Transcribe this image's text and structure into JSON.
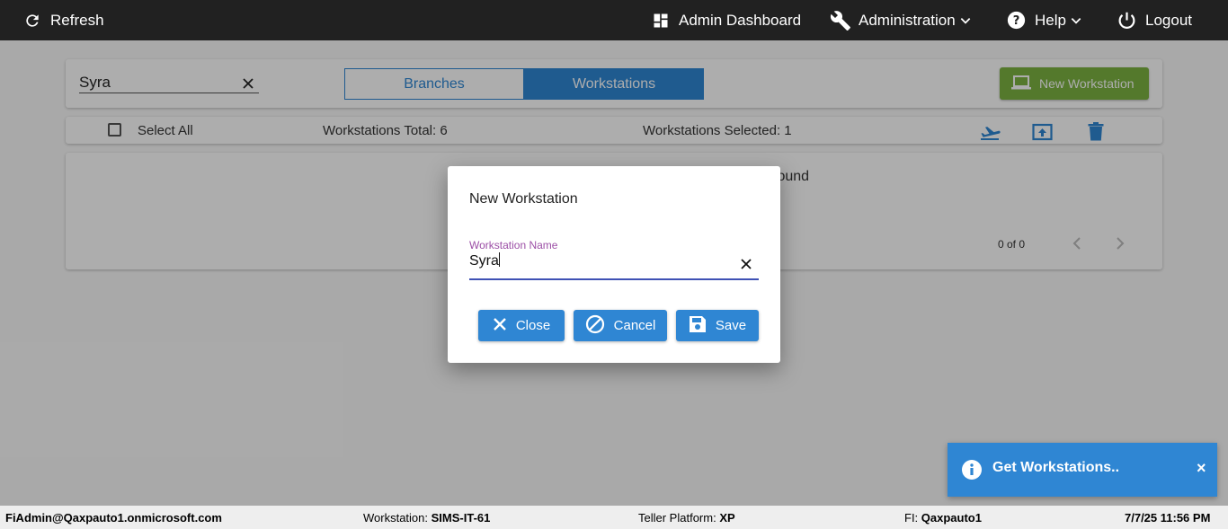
{
  "topbar": {
    "refresh_label": "Refresh",
    "admin_dashboard_label": "Admin Dashboard",
    "administration_label": "Administration",
    "help_label": "Help",
    "logout_label": "Logout"
  },
  "search": {
    "value": "Syra"
  },
  "tabs": [
    {
      "label": "Branches",
      "active": false
    },
    {
      "label": "Workstations",
      "active": true
    }
  ],
  "new_workstation_label": "New Workstation",
  "list_header": {
    "select_all_label": "Select All",
    "total_label": "Workstations Total: 6",
    "selected_label": "Workstations Selected: 1"
  },
  "list": {
    "empty_text_fragment": "found",
    "pager_text": "0 of 0"
  },
  "dialog": {
    "title": "New Workstation",
    "field_label": "Workstation Name",
    "field_value": "Syra",
    "close_label": "Close",
    "cancel_label": "Cancel",
    "save_label": "Save"
  },
  "toast": {
    "text": "Get Workstations..",
    "close_glyph": "×"
  },
  "statusbar": {
    "user": "FiAdmin@Qaxpauto1.onmicrosoft.com",
    "workstation_label": "Workstation:",
    "workstation_value": "SIMS-IT-61",
    "platform_label": "Teller Platform:",
    "platform_value": "XP",
    "fi_label": "FI:",
    "fi_value": "Qaxpauto1",
    "datetime": "7/7/25 11:56 PM"
  },
  "colors": {
    "topbar": "#212121",
    "primary_blue": "#2f86d3",
    "green": "#7cb342",
    "field_label": "#9c4fa6",
    "field_underline": "#3f51b5"
  },
  "icons": [
    "refresh-icon",
    "dashboard-icon",
    "wrench-icon",
    "help-icon",
    "chevron-down-icon",
    "power-icon",
    "laptop-icon",
    "airplane-icon",
    "upload-icon",
    "trash-icon",
    "close-icon",
    "cancel-icon",
    "save-icon",
    "info-icon"
  ]
}
